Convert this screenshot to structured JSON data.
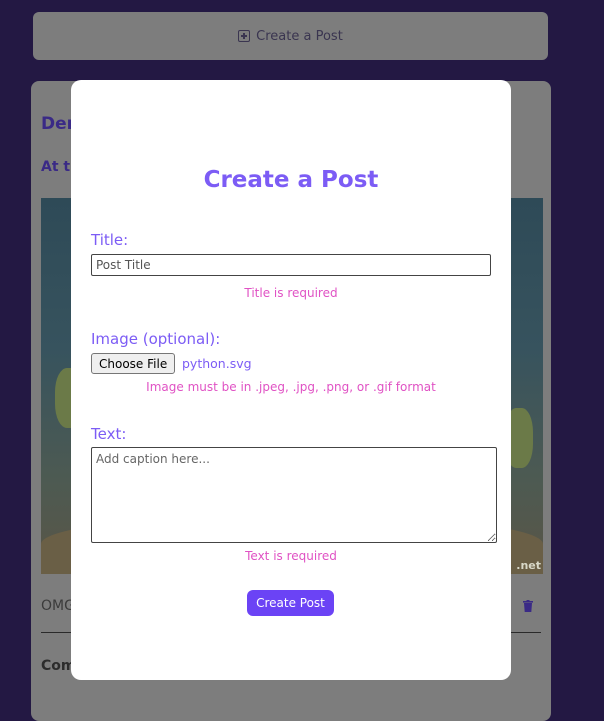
{
  "background": {
    "create_bar": {
      "label": "Create a Post",
      "icon": "plus-square-icon"
    },
    "post": {
      "title": "Der",
      "subtitle": "At th",
      "caption": "OMG",
      "delete_icon": "trash-icon",
      "comments_label": "Com",
      "image_watermark": ".net"
    }
  },
  "modal": {
    "heading": "Create a Post",
    "title_label": "Title:",
    "title_placeholder": "Post Title",
    "title_value": "",
    "title_error": "Title is required",
    "image_label": "Image (optional):",
    "choose_file_label": "Choose File",
    "file_name": "python.svg",
    "image_error": "Image must be in .jpeg, .jpg, .png, or .gif format",
    "text_label": "Text:",
    "text_placeholder": "Add caption here...",
    "text_value": "",
    "text_error": "Text is required",
    "submit_label": "Create Post"
  },
  "colors": {
    "accent": "#7c5cf5",
    "button": "#6b43f5",
    "error": "#e052c4",
    "page_background": "#231843"
  }
}
